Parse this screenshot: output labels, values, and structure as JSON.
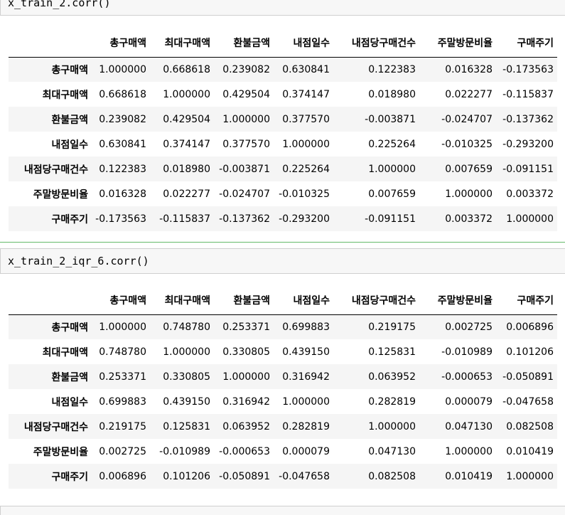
{
  "cells": [
    {
      "code": "x_train_2.corr()",
      "columns": [
        "",
        "총구매액",
        "최대구매액",
        "환불금액",
        "내점일수",
        "내점당구매건수",
        "주말방문비율",
        "구매주기"
      ],
      "rows": [
        {
          "index": "총구매액",
          "values": [
            "1.000000",
            "0.668618",
            "0.239082",
            "0.630841",
            "0.122383",
            "0.016328",
            "-0.173563"
          ]
        },
        {
          "index": "최대구매액",
          "values": [
            "0.668618",
            "1.000000",
            "0.429504",
            "0.374147",
            "0.018980",
            "0.022277",
            "-0.115837"
          ]
        },
        {
          "index": "환불금액",
          "values": [
            "0.239082",
            "0.429504",
            "1.000000",
            "0.377570",
            "-0.003871",
            "-0.024707",
            "-0.137362"
          ]
        },
        {
          "index": "내점일수",
          "values": [
            "0.630841",
            "0.374147",
            "0.377570",
            "1.000000",
            "0.225264",
            "-0.010325",
            "-0.293200"
          ]
        },
        {
          "index": "내점당구매건수",
          "values": [
            "0.122383",
            "0.018980",
            "-0.003871",
            "0.225264",
            "1.000000",
            "0.007659",
            "-0.091151"
          ]
        },
        {
          "index": "주말방문비율",
          "values": [
            "0.016328",
            "0.022277",
            "-0.024707",
            "-0.010325",
            "0.007659",
            "1.000000",
            "0.003372"
          ]
        },
        {
          "index": "구매주기",
          "values": [
            "-0.173563",
            "-0.115837",
            "-0.137362",
            "-0.293200",
            "-0.091151",
            "0.003372",
            "1.000000"
          ]
        }
      ]
    },
    {
      "code": "x_train_2_iqr_6.corr()",
      "columns": [
        "",
        "총구매액",
        "최대구매액",
        "환불금액",
        "내점일수",
        "내점당구매건수",
        "주말방문비율",
        "구매주기"
      ],
      "rows": [
        {
          "index": "총구매액",
          "values": [
            "1.000000",
            "0.748780",
            "0.253371",
            "0.699883",
            "0.219175",
            "0.002725",
            "0.006896"
          ]
        },
        {
          "index": "최대구매액",
          "values": [
            "0.748780",
            "1.000000",
            "0.330805",
            "0.439150",
            "0.125831",
            "-0.010989",
            "0.101206"
          ]
        },
        {
          "index": "환불금액",
          "values": [
            "0.253371",
            "0.330805",
            "1.000000",
            "0.316942",
            "0.063952",
            "-0.000653",
            "-0.050891"
          ]
        },
        {
          "index": "내점일수",
          "values": [
            "0.699883",
            "0.439150",
            "0.316942",
            "1.000000",
            "0.282819",
            "0.000079",
            "-0.047658"
          ]
        },
        {
          "index": "내점당구매건수",
          "values": [
            "0.219175",
            "0.125831",
            "0.063952",
            "0.282819",
            "1.000000",
            "0.047130",
            "0.082508"
          ]
        },
        {
          "index": "주말방문비율",
          "values": [
            "0.002725",
            "-0.010989",
            "-0.000653",
            "0.000079",
            "0.047130",
            "1.000000",
            "0.010419"
          ]
        },
        {
          "index": "구매주기",
          "values": [
            "0.006896",
            "0.101206",
            "-0.050891",
            "-0.047658",
            "0.082508",
            "0.010419",
            "1.000000"
          ]
        }
      ]
    }
  ]
}
